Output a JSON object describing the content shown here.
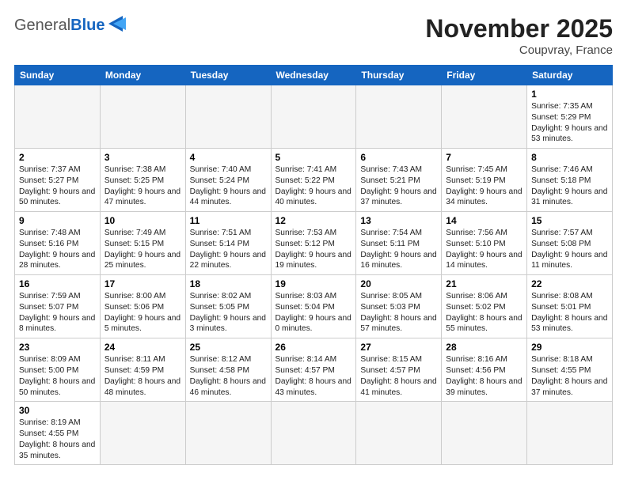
{
  "header": {
    "logo": {
      "text_general": "General",
      "text_blue": "Blue"
    },
    "title": "November 2025",
    "location": "Coupvray, France"
  },
  "weekdays": [
    "Sunday",
    "Monday",
    "Tuesday",
    "Wednesday",
    "Thursday",
    "Friday",
    "Saturday"
  ],
  "weeks": [
    [
      {
        "day": "",
        "info": ""
      },
      {
        "day": "",
        "info": ""
      },
      {
        "day": "",
        "info": ""
      },
      {
        "day": "",
        "info": ""
      },
      {
        "day": "",
        "info": ""
      },
      {
        "day": "",
        "info": ""
      },
      {
        "day": "1",
        "info": "Sunrise: 7:35 AM\nSunset: 5:29 PM\nDaylight: 9 hours and 53 minutes."
      }
    ],
    [
      {
        "day": "2",
        "info": "Sunrise: 7:37 AM\nSunset: 5:27 PM\nDaylight: 9 hours and 50 minutes."
      },
      {
        "day": "3",
        "info": "Sunrise: 7:38 AM\nSunset: 5:25 PM\nDaylight: 9 hours and 47 minutes."
      },
      {
        "day": "4",
        "info": "Sunrise: 7:40 AM\nSunset: 5:24 PM\nDaylight: 9 hours and 44 minutes."
      },
      {
        "day": "5",
        "info": "Sunrise: 7:41 AM\nSunset: 5:22 PM\nDaylight: 9 hours and 40 minutes."
      },
      {
        "day": "6",
        "info": "Sunrise: 7:43 AM\nSunset: 5:21 PM\nDaylight: 9 hours and 37 minutes."
      },
      {
        "day": "7",
        "info": "Sunrise: 7:45 AM\nSunset: 5:19 PM\nDaylight: 9 hours and 34 minutes."
      },
      {
        "day": "8",
        "info": "Sunrise: 7:46 AM\nSunset: 5:18 PM\nDaylight: 9 hours and 31 minutes."
      }
    ],
    [
      {
        "day": "9",
        "info": "Sunrise: 7:48 AM\nSunset: 5:16 PM\nDaylight: 9 hours and 28 minutes."
      },
      {
        "day": "10",
        "info": "Sunrise: 7:49 AM\nSunset: 5:15 PM\nDaylight: 9 hours and 25 minutes."
      },
      {
        "day": "11",
        "info": "Sunrise: 7:51 AM\nSunset: 5:14 PM\nDaylight: 9 hours and 22 minutes."
      },
      {
        "day": "12",
        "info": "Sunrise: 7:53 AM\nSunset: 5:12 PM\nDaylight: 9 hours and 19 minutes."
      },
      {
        "day": "13",
        "info": "Sunrise: 7:54 AM\nSunset: 5:11 PM\nDaylight: 9 hours and 16 minutes."
      },
      {
        "day": "14",
        "info": "Sunrise: 7:56 AM\nSunset: 5:10 PM\nDaylight: 9 hours and 14 minutes."
      },
      {
        "day": "15",
        "info": "Sunrise: 7:57 AM\nSunset: 5:08 PM\nDaylight: 9 hours and 11 minutes."
      }
    ],
    [
      {
        "day": "16",
        "info": "Sunrise: 7:59 AM\nSunset: 5:07 PM\nDaylight: 9 hours and 8 minutes."
      },
      {
        "day": "17",
        "info": "Sunrise: 8:00 AM\nSunset: 5:06 PM\nDaylight: 9 hours and 5 minutes."
      },
      {
        "day": "18",
        "info": "Sunrise: 8:02 AM\nSunset: 5:05 PM\nDaylight: 9 hours and 3 minutes."
      },
      {
        "day": "19",
        "info": "Sunrise: 8:03 AM\nSunset: 5:04 PM\nDaylight: 9 hours and 0 minutes."
      },
      {
        "day": "20",
        "info": "Sunrise: 8:05 AM\nSunset: 5:03 PM\nDaylight: 8 hours and 57 minutes."
      },
      {
        "day": "21",
        "info": "Sunrise: 8:06 AM\nSunset: 5:02 PM\nDaylight: 8 hours and 55 minutes."
      },
      {
        "day": "22",
        "info": "Sunrise: 8:08 AM\nSunset: 5:01 PM\nDaylight: 8 hours and 53 minutes."
      }
    ],
    [
      {
        "day": "23",
        "info": "Sunrise: 8:09 AM\nSunset: 5:00 PM\nDaylight: 8 hours and 50 minutes."
      },
      {
        "day": "24",
        "info": "Sunrise: 8:11 AM\nSunset: 4:59 PM\nDaylight: 8 hours and 48 minutes."
      },
      {
        "day": "25",
        "info": "Sunrise: 8:12 AM\nSunset: 4:58 PM\nDaylight: 8 hours and 46 minutes."
      },
      {
        "day": "26",
        "info": "Sunrise: 8:14 AM\nSunset: 4:57 PM\nDaylight: 8 hours and 43 minutes."
      },
      {
        "day": "27",
        "info": "Sunrise: 8:15 AM\nSunset: 4:57 PM\nDaylight: 8 hours and 41 minutes."
      },
      {
        "day": "28",
        "info": "Sunrise: 8:16 AM\nSunset: 4:56 PM\nDaylight: 8 hours and 39 minutes."
      },
      {
        "day": "29",
        "info": "Sunrise: 8:18 AM\nSunset: 4:55 PM\nDaylight: 8 hours and 37 minutes."
      }
    ],
    [
      {
        "day": "30",
        "info": "Sunrise: 8:19 AM\nSunset: 4:55 PM\nDaylight: 8 hours and 35 minutes."
      },
      {
        "day": "",
        "info": ""
      },
      {
        "day": "",
        "info": ""
      },
      {
        "day": "",
        "info": ""
      },
      {
        "day": "",
        "info": ""
      },
      {
        "day": "",
        "info": ""
      },
      {
        "day": "",
        "info": ""
      }
    ]
  ]
}
